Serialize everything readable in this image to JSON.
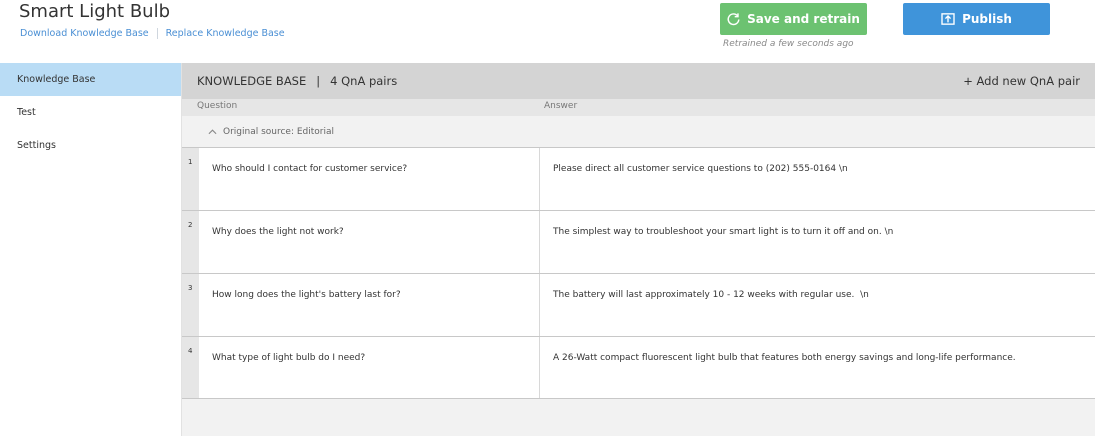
{
  "header": {
    "title": "Smart Light Bulb",
    "download_link": "Download Knowledge Base",
    "replace_link": "Replace Knowledge Base",
    "save_retrain_label": "Save and retrain",
    "publish_label": "Publish",
    "retrained_status": "Retrained a few seconds ago"
  },
  "sidebar": {
    "items": [
      {
        "label": "Knowledge Base",
        "active": true
      },
      {
        "label": "Test",
        "active": false
      },
      {
        "label": "Settings",
        "active": false
      }
    ]
  },
  "kb": {
    "title": "KNOWLEDGE BASE",
    "divider": "|",
    "pair_count": "4 QnA pairs",
    "add_label": "+ Add new QnA pair",
    "col_question": "Question",
    "col_answer": "Answer",
    "source": "Original source: Editorial",
    "pairs": [
      {
        "num": "1",
        "question": "Who should I contact for customer service?",
        "answer": "Please direct all customer service questions to (202) 555-0164 \\n"
      },
      {
        "num": "2",
        "question": "Why does the light not work?",
        "answer": "The simplest way to troubleshoot your smart light is to turn it off and on. \\n"
      },
      {
        "num": "3",
        "question": "How long does the light's battery last for?",
        "answer": "The battery will last approximately 10 - 12 weeks with regular use.  \\n"
      },
      {
        "num": "4",
        "question": "What type of light bulb do I need?",
        "answer": "A 26-Watt compact fluorescent light bulb that features both energy savings and long-life performance."
      }
    ]
  },
  "colors": {
    "retrain_green": "#6cc271",
    "publish_blue": "#3f94da",
    "active_sidebar": "#b9dcf5",
    "link_blue": "#4a8fd4"
  },
  "icons": {
    "retrain": "refresh-icon",
    "publish": "publish-upload-icon",
    "source_toggle": "chevron-up-icon"
  }
}
